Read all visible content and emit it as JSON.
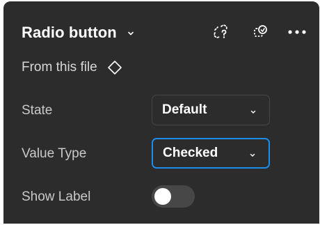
{
  "header": {
    "title": "Radio button",
    "icons": {
      "detach": "detach-instance-icon",
      "swap": "swap-instance-icon",
      "more": "more-options-icon"
    }
  },
  "source": {
    "label": "From this file",
    "icon": "component-diamond-icon"
  },
  "properties": {
    "state": {
      "label": "State",
      "value": "Default"
    },
    "value_type": {
      "label": "Value Type",
      "value": "Checked"
    },
    "show_label": {
      "label": "Show Label",
      "on": false
    }
  },
  "colors": {
    "panel_bg": "#2c2c2c",
    "accent_focus": "#1c8ce9",
    "toggle_off": "#474747"
  }
}
